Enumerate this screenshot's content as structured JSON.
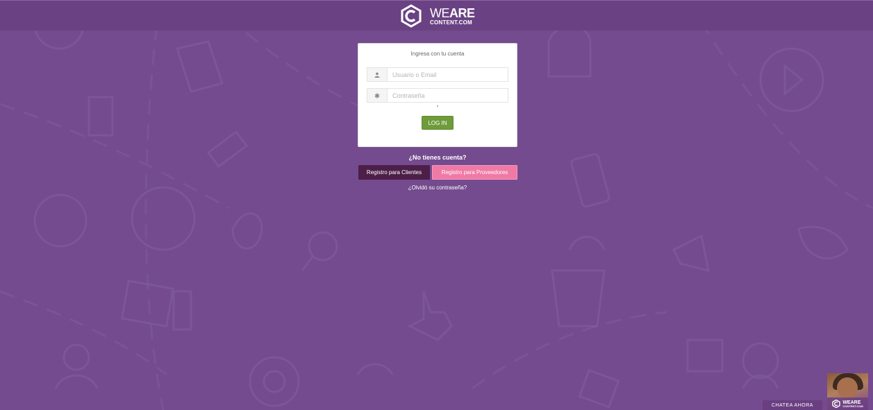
{
  "brand": {
    "logo_line1_thin": "WE",
    "logo_line1_bold": "ARE",
    "logo_line2": "CONTENT.COM",
    "background_color": "#744b8e",
    "header_color": "#6a4283"
  },
  "login": {
    "title": "Ingresa con tu cuenta",
    "username_placeholder": "Usuario o Email",
    "password_placeholder": "Contraseña",
    "username_icon": "user-icon",
    "password_icon": "asterisk-icon",
    "submit_label": "LOG IN",
    "submit_color": "#6f9b3b"
  },
  "signup": {
    "prompt": "¿No tienes cuenta?",
    "clients_label": "Registro para Clientes",
    "providers_label": "Registro para Proveedores",
    "forgot_label": "¿Olvidó su contraseña?"
  },
  "chat": {
    "label": "CHATEA AHORA",
    "mini_logo_top": "WEARE",
    "mini_logo_bottom": "CONTENT.COM"
  }
}
